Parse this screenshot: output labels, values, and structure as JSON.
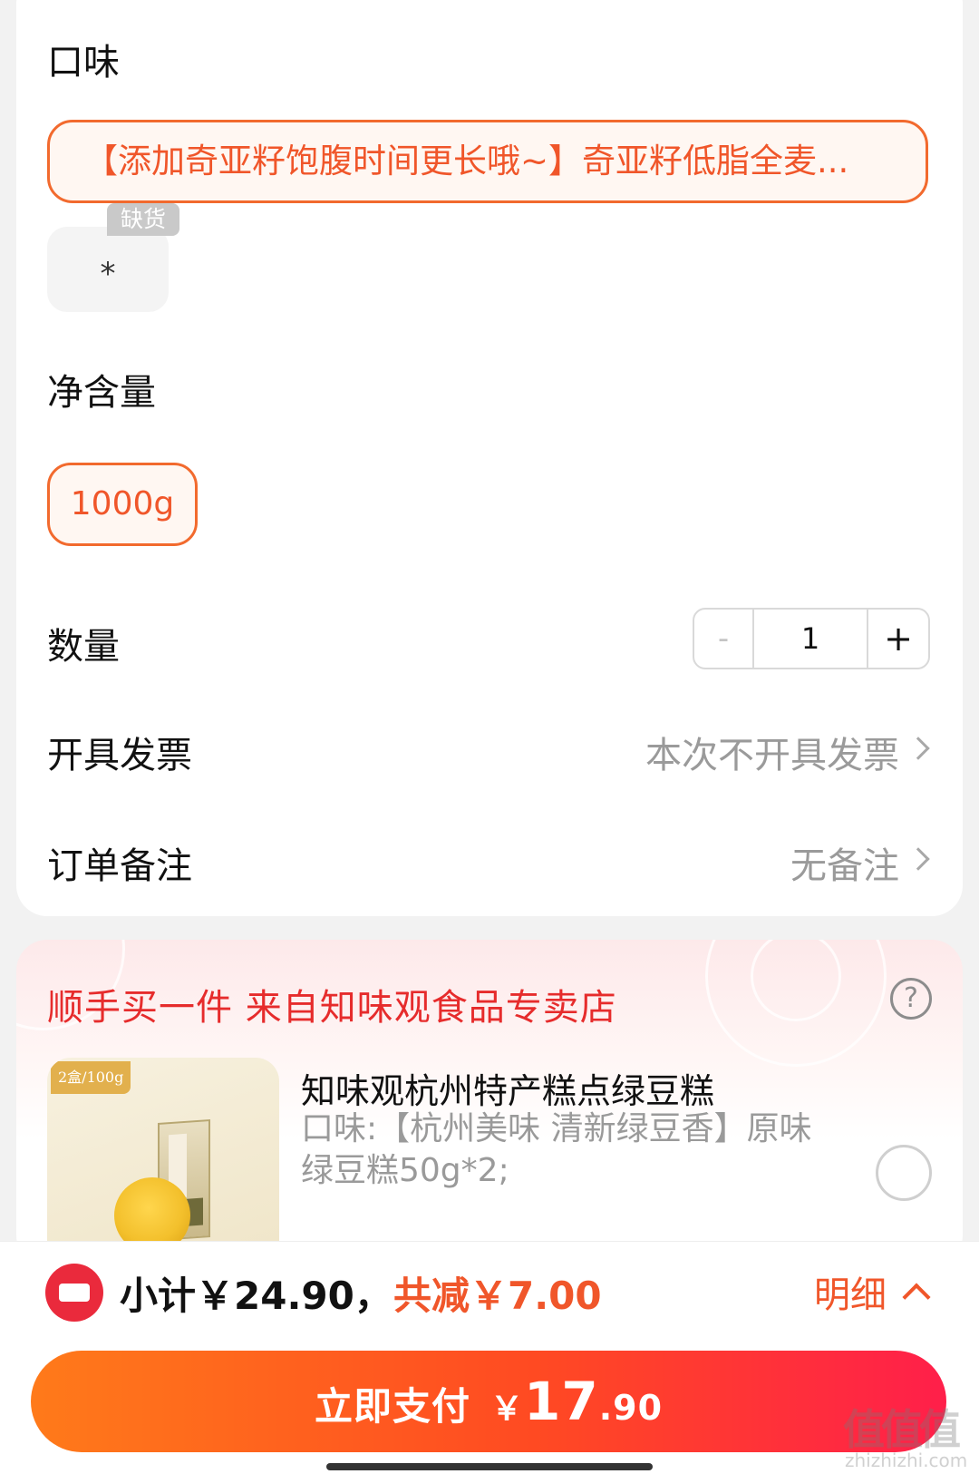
{
  "options": {
    "flavor_title": "口味",
    "flavor_option": "【添加奇亚籽饱腹时间更长哦~】奇亚籽低脂全麦...",
    "out_of_stock_badge": "缺货",
    "out_of_stock_option": "*",
    "size_title": "净含量",
    "size_option": "1000g"
  },
  "quantity": {
    "label": "数量",
    "minus": "-",
    "value": "1",
    "plus": "+"
  },
  "invoice": {
    "label": "开具发票",
    "value": "本次不开具发票"
  },
  "remark": {
    "label": "订单备注",
    "value": "无备注"
  },
  "promo": {
    "title": "顺手买一件  来自知味观食品专卖店",
    "help": "?",
    "product_tag": "2盒/100g",
    "product_name": "知味观杭州特产糕点绿豆糕",
    "product_spec": "口味:【杭州美味 清新绿豆香】原味绿豆糕50g*2;"
  },
  "footer": {
    "subtotal": "小计￥24.90，",
    "discount": "共减￥7.00",
    "detail": "明细",
    "pay_label": "立即支付",
    "currency": "￥",
    "pay_int": "17",
    "pay_dec": ".90"
  },
  "watermark": {
    "main": "值值值",
    "sub": "zhizhizhi.com"
  },
  "colors": {
    "accent": "#f0562a",
    "promo_red": "#e62c2c",
    "muted_text": "#9a9a9a"
  }
}
